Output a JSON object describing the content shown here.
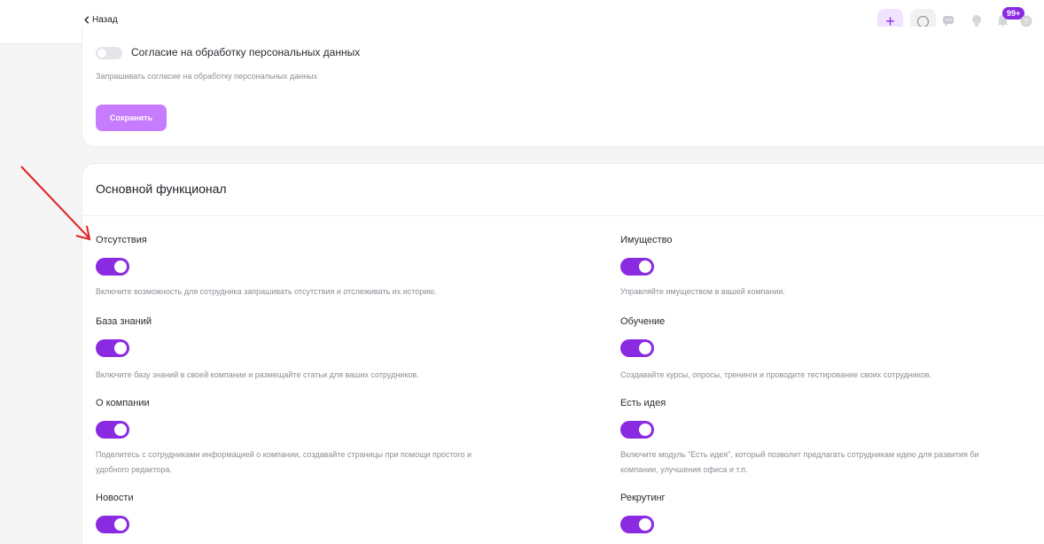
{
  "header": {
    "back_label": "Назад",
    "notifications_badge": "99+"
  },
  "consent": {
    "label": "Согласие на обработку персональных данных",
    "description": "Запрашивать согласие на обработку персональных данных",
    "enabled": false,
    "save_label": "Сохранить"
  },
  "main": {
    "title": "Основной функционал",
    "features": [
      {
        "title": "Отсутствия",
        "enabled": true,
        "description": "Включите возможность для сотрудника запрашивать отсутствия и отслеживать их историю."
      },
      {
        "title": "Имущество",
        "enabled": true,
        "description": "Управляйте имуществом в вашей компании."
      },
      {
        "title": "База знаний",
        "enabled": true,
        "description": "Включите базу знаний в своей компании и размещайте статьи для ваших сотрудников."
      },
      {
        "title": "Обучение",
        "enabled": true,
        "description": "Создавайте курсы, опросы, тренинги и проводите тестирование своих сотрудников."
      },
      {
        "title": "О компании",
        "enabled": true,
        "description_line1": "Поделитесь с сотрудниками информацией о компании, создавайте страницы при помощи простого и",
        "description_line2": "удобного редактора."
      },
      {
        "title": "Есть идея",
        "enabled": true,
        "description_line1": "Включите модуль \"Есть идея\", который позволит предлагать сотрудникам идею для развития би",
        "description_line2": "компании, улучшения офиса и т.п."
      },
      {
        "title": "Новости",
        "enabled": true
      },
      {
        "title": "Рекрутинг",
        "enabled": true
      }
    ]
  },
  "colors": {
    "accent": "#8a2be2",
    "save_button": "#c77bff",
    "annotation_arrow": "#e02020"
  }
}
